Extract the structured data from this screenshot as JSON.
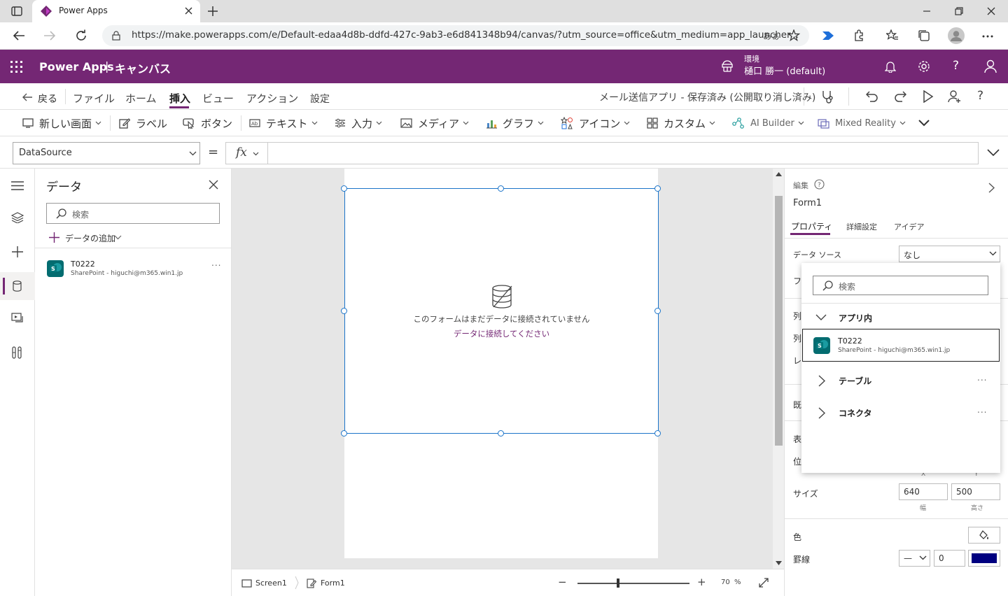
{
  "browser": {
    "tab_title": "Power Apps",
    "url": "https://make.powerapps.com/e/Default-edaa4d8b-ddfd-427c-9ab3-e6d841348b94/canvas/?utm_source=office&utm_medium=app_launcher...",
    "reader_label": "あぁ"
  },
  "app": {
    "brand": "Power Apps",
    "separator": "|",
    "section": "キャンバス",
    "env_label": "環境",
    "env_name": "樋口 勝一 (default)"
  },
  "cmdbar": {
    "back": "戻る",
    "menus": [
      "ファイル",
      "ホーム",
      "挿入",
      "ビュー",
      "アクション",
      "設定"
    ],
    "active_menu": "挿入",
    "status": "メール送信アプリ - 保存済み (公開取り消し済み)"
  },
  "ribbon": {
    "new_screen": "新しい画面",
    "label": "ラベル",
    "button": "ボタン",
    "text": "テキスト",
    "input": "入力",
    "media": "メディア",
    "chart": "グラフ",
    "icon": "アイコン",
    "custom": "カスタム",
    "ai_builder": "AI Builder",
    "mixed_reality": "Mixed Reality"
  },
  "formula": {
    "property": "DataSource",
    "equals": "=",
    "fx": "fx",
    "value": ""
  },
  "datapanel": {
    "title": "データ",
    "search_placeholder": "検索",
    "add_data": "データの追加",
    "sources": [
      {
        "name": "T0222",
        "sub": "SharePoint - higuchi@m365.win1.jp"
      }
    ],
    "more": "..."
  },
  "canvas": {
    "empty_msg": "このフォームはまだデータに接続されていません",
    "connect_link": "データに接続してください",
    "screen_crumb": "Screen1",
    "form_crumb": "Form1",
    "zoom_minus": "−",
    "zoom_plus": "+",
    "zoom_value": "70",
    "zoom_unit": "%"
  },
  "props": {
    "edit_label": "編集",
    "control_name": "Form1",
    "tabs": [
      "プロパティ",
      "詳細設定",
      "アイデア"
    ],
    "datasource_label": "データ ソース",
    "datasource_value": "なし",
    "partial_labels": [
      "フィ",
      "列",
      "列",
      "レ",
      "既",
      "表",
      "位"
    ],
    "x_label": "X",
    "y_label": "Y",
    "size_label": "サイズ",
    "width_value": "640",
    "height_value": "500",
    "width_sub": "幅",
    "height_sub": "高さ",
    "color_label": "色",
    "border_label": "罫線",
    "border_style": "—",
    "border_width": "0",
    "border_color": "#000080"
  },
  "dropdown": {
    "search_placeholder": "検索",
    "section_in_app": "アプリ内",
    "item": {
      "name": "T0222",
      "sub": "SharePoint - higuchi@m365.win1.jp"
    },
    "tables": "テーブル",
    "connectors": "コネクタ",
    "more": "..."
  },
  "colors": {
    "brand_purple": "#742774",
    "selection_blue": "#1b74c9",
    "sharepoint_teal": "#036c70"
  }
}
